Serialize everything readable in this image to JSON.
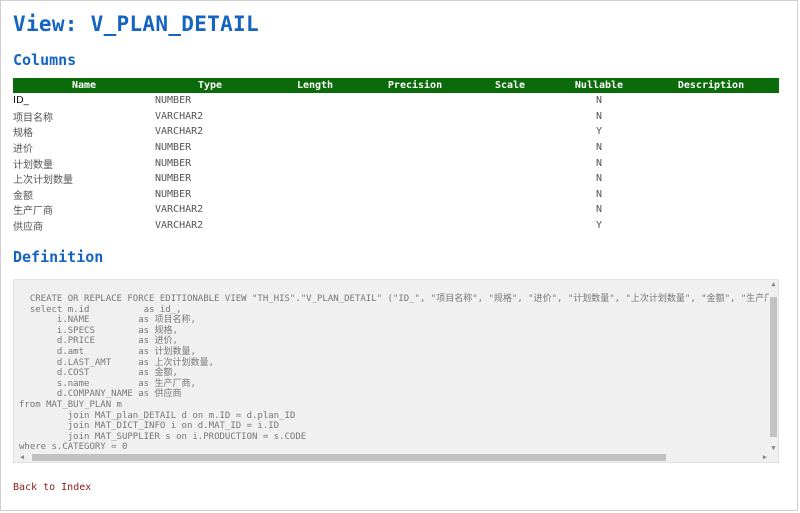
{
  "page": {
    "title": "View: V_PLAN_DETAIL",
    "columns_heading": "Columns",
    "definition_heading": "Definition",
    "back_link": "Back to Index"
  },
  "colors": {
    "heading": "#1565c0",
    "table_header_bg": "#0b6b0b",
    "link": "#8b1a1a"
  },
  "table": {
    "headers": [
      "Name",
      "Type",
      "Length",
      "Precision",
      "Scale",
      "Nullable",
      "Description"
    ],
    "rows": [
      {
        "name": "ID_",
        "type": "NUMBER",
        "length": "",
        "precision": "",
        "scale": "",
        "nullable": "N",
        "description": ""
      },
      {
        "name": "项目名称",
        "type": "VARCHAR2",
        "length": "",
        "precision": "",
        "scale": "",
        "nullable": "N",
        "description": ""
      },
      {
        "name": "规格",
        "type": "VARCHAR2",
        "length": "",
        "precision": "",
        "scale": "",
        "nullable": "Y",
        "description": ""
      },
      {
        "name": "进价",
        "type": "NUMBER",
        "length": "",
        "precision": "",
        "scale": "",
        "nullable": "N",
        "description": ""
      },
      {
        "name": "计划数量",
        "type": "NUMBER",
        "length": "",
        "precision": "",
        "scale": "",
        "nullable": "N",
        "description": ""
      },
      {
        "name": "上次计划数量",
        "type": "NUMBER",
        "length": "",
        "precision": "",
        "scale": "",
        "nullable": "N",
        "description": ""
      },
      {
        "name": "金额",
        "type": "NUMBER",
        "length": "",
        "precision": "",
        "scale": "",
        "nullable": "N",
        "description": ""
      },
      {
        "name": "生产厂商",
        "type": "VARCHAR2",
        "length": "",
        "precision": "",
        "scale": "",
        "nullable": "N",
        "description": ""
      },
      {
        "name": "供应商",
        "type": "VARCHAR2",
        "length": "",
        "precision": "",
        "scale": "",
        "nullable": "Y",
        "description": ""
      }
    ]
  },
  "definition": {
    "sql": "  CREATE OR REPLACE FORCE EDITIONABLE VIEW \"TH_HIS\".\"V_PLAN_DETAIL\" (\"ID_\", \"项目名称\", \"规格\", \"进价\", \"计划数量\", \"上次计划数量\", \"金额\", \"生产厂\n  select m.id          as id_,\n       i.NAME         as 项目名称,\n       i.SPECS        as 规格,\n       d.PRICE        as 进价,\n       d.amt          as 计划数量,\n       d.LAST_AMT     as 上次计划数量,\n       d.COST         as 金额,\n       s.name         as 生产厂商,\n       d.COMPANY_NAME as 供应商\nfrom MAT_BUY_PLAN m\n         join MAT_plan_DETAIL d on m.ID = d.plan_ID\n         join MAT_DICT_INFO i on d.MAT_ID = i.ID\n         join MAT_SUPPLIER s on i.PRODUCTION = s.CODE\nwhere s.CATEGORY = 0"
  },
  "icons": {
    "scroll_up": "triangle-up",
    "scroll_down": "triangle-down",
    "scroll_left": "triangle-left",
    "scroll_right": "triangle-right"
  }
}
